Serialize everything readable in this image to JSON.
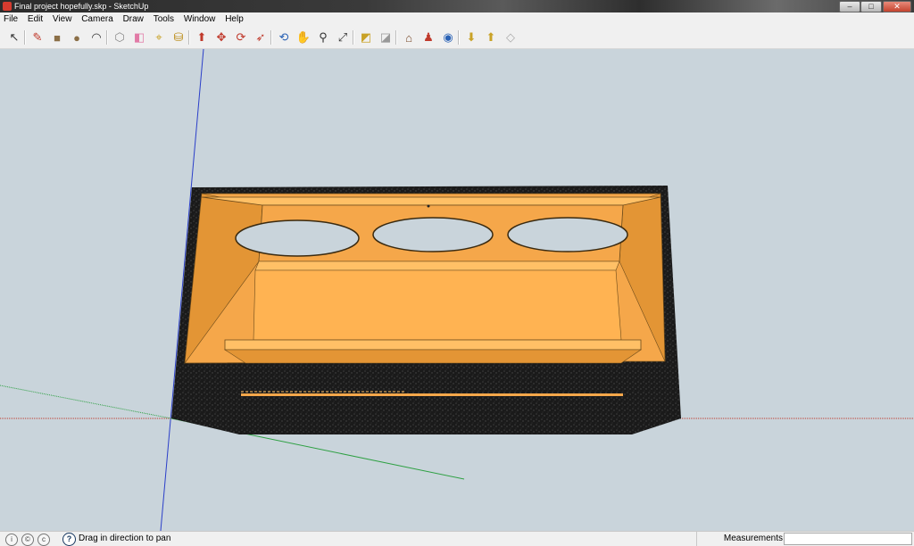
{
  "window": {
    "title": "Final project hopefully.skp - SketchUp",
    "controls": {
      "minimize": "–",
      "maximize": "□",
      "close": "✕"
    }
  },
  "menu": [
    "File",
    "Edit",
    "View",
    "Camera",
    "Draw",
    "Tools",
    "Window",
    "Help"
  ],
  "toolbar": {
    "tools": [
      {
        "name": "select-icon",
        "glyph": "↖",
        "color": "#333333"
      },
      {
        "name": "pencil-icon",
        "glyph": "✎",
        "color": "#c0392b"
      },
      {
        "name": "rectangle-icon",
        "glyph": "■",
        "color": "#8b6f47"
      },
      {
        "name": "circle-icon",
        "glyph": "●",
        "color": "#8b6f47"
      },
      {
        "name": "arc-icon",
        "glyph": "◠",
        "color": "#333333"
      },
      {
        "name": "make-component-icon",
        "glyph": "⬡",
        "color": "#888888"
      },
      {
        "name": "eraser-icon",
        "glyph": "◧",
        "color": "#e27aa6"
      },
      {
        "name": "tape-measure-icon",
        "glyph": "⌖",
        "color": "#c9a227"
      },
      {
        "name": "paint-bucket-icon",
        "glyph": "⛁",
        "color": "#b8860b"
      },
      {
        "name": "push-pull-icon",
        "glyph": "⬆",
        "color": "#c0392b"
      },
      {
        "name": "move-icon",
        "glyph": "✥",
        "color": "#c0392b"
      },
      {
        "name": "rotate-icon",
        "glyph": "⟳",
        "color": "#c0392b"
      },
      {
        "name": "follow-me-icon",
        "glyph": "➶",
        "color": "#c0392b"
      },
      {
        "name": "orbit-icon",
        "glyph": "⟲",
        "color": "#2a62b5"
      },
      {
        "name": "pan-icon",
        "glyph": "✋",
        "color": "#555555"
      },
      {
        "name": "zoom-icon",
        "glyph": "⚲",
        "color": "#333333"
      },
      {
        "name": "zoom-extents-icon",
        "glyph": "⤢",
        "color": "#333333"
      },
      {
        "name": "previous-view-icon",
        "glyph": "◩",
        "color": "#c9a227"
      },
      {
        "name": "next-view-icon",
        "glyph": "◪",
        "color": "#999999"
      },
      {
        "name": "get-models-icon",
        "glyph": "⌂",
        "color": "#7a4a2a"
      },
      {
        "name": "share-model-icon",
        "glyph": "♟",
        "color": "#c0392b"
      },
      {
        "name": "google-earth-icon",
        "glyph": "◉",
        "color": "#2a62b5"
      },
      {
        "name": "get-components-icon",
        "glyph": "⬇",
        "color": "#c9a227"
      },
      {
        "name": "share-component-icon",
        "glyph": "⬆",
        "color": "#c9a227"
      },
      {
        "name": "extension-icon",
        "glyph": "◇",
        "color": "#aaaaaa"
      }
    ]
  },
  "scene": {
    "colors": {
      "background": "#c9d4db",
      "wood": "#f5a74a",
      "wood_light": "#ffc066",
      "carpet": "#1a1a1a"
    },
    "axes": {
      "x": "#c0392b",
      "y": "#2ea043",
      "z": "#2b3fc9"
    }
  },
  "status": {
    "message": "Drag in direction to pan",
    "help_glyph": "?",
    "measurements_label": "Measurements",
    "measurements_value": ""
  }
}
